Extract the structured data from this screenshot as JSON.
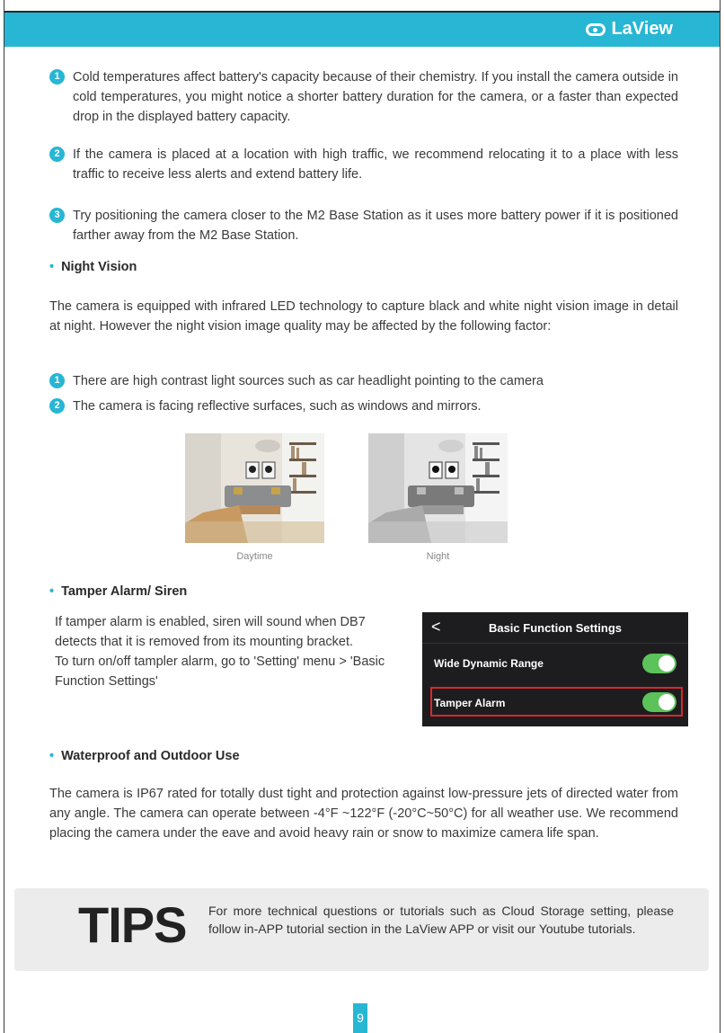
{
  "brand": {
    "name": "LaView"
  },
  "battery_tips": [
    {
      "num": "1",
      "text": "Cold temperatures affect battery's capacity because of their chemistry. If you install the camera outside in cold temperatures, you might notice a shorter battery duration for the camera, or a faster than expected drop in the displayed battery capacity."
    },
    {
      "num": "2",
      "text": "If the camera is placed at a location with high traffic, we recommend relocating it to a place with less traffic to receive less alerts and extend battery life."
    },
    {
      "num": "3",
      "text": "Try positioning the camera closer to the M2 Base Station as it uses more battery power if it is positioned farther away from the M2 Base Station."
    }
  ],
  "night_vision": {
    "heading": "Night Vision",
    "body": "The camera is equipped with infrared LED technology to capture black and white night vision image in detail at night. However the night vision image quality may be affected by the following factor:",
    "items": [
      {
        "num": "1",
        "text": "There are high contrast light sources such as car headlight pointing to the camera"
      },
      {
        "num": "2",
        "text": "The camera is facing reflective surfaces, such as windows and mirrors."
      }
    ],
    "captions": {
      "day": "Daytime",
      "night": "Night"
    }
  },
  "tamper": {
    "heading": "Tamper Alarm/ Siren",
    "line1": "If tamper alarm is enabled, siren will sound when DB7 detects that it is removed from its mounting bracket.",
    "line2": "To turn on/off tampler alarm, go to 'Setting' menu > 'Basic Function Settings'",
    "app": {
      "title": "Basic Function Settings",
      "back": "<",
      "row1": "Wide Dynamic Range",
      "row2": "Tamper Alarm"
    }
  },
  "waterproof": {
    "heading": "Waterproof and Outdoor Use",
    "body": "The camera is IP67 rated for totally dust tight and protection against low-pressure jets of directed water from any angle. The camera can operate between -4°F ~122°F (-20°C~50°C) for all weather use. We recommend placing the camera under the eave and avoid heavy rain or snow to maximize camera life span."
  },
  "tips": {
    "label": "TIPS",
    "text": "For more technical questions or tutorials such as Cloud Storage setting, please follow in-APP tutorial section in the LaView APP or visit our Youtube tutorials."
  },
  "page_number": "9",
  "colors": {
    "accent": "#27b6d4",
    "toggle_on": "#5cc25a",
    "highlight": "#d9262c"
  }
}
